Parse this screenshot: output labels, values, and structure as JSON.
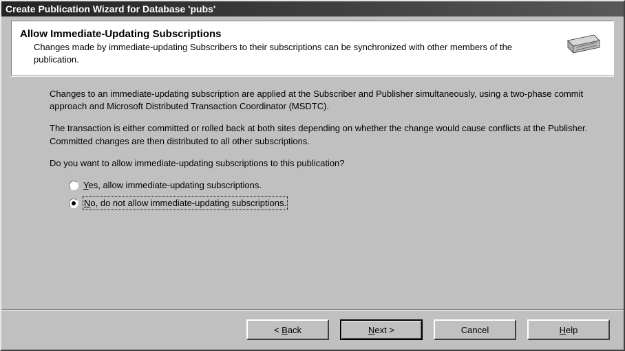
{
  "titlebar": "Create Publication Wizard for Database 'pubs'",
  "header": {
    "title": "Allow Immediate-Updating Subscriptions",
    "description": "Changes made by immediate-updating Subscribers to their subscriptions can be synchronized with other members of the publication."
  },
  "body": {
    "para1": "Changes to an immediate-updating subscription are applied at the Subscriber and Publisher simultaneously, using a two-phase commit approach and Microsoft Distributed Transaction Coordinator (MSDTC).",
    "para2": "The transaction is either committed or rolled back at both sites depending on whether the change would cause conflicts at the Publisher. Committed changes are then distributed to all other subscriptions.",
    "question": "Do you want to allow immediate-updating subscriptions to this publication?"
  },
  "options": {
    "yes_accel": "Y",
    "yes_rest": "es, allow immediate-updating subscriptions.",
    "no_accel": "N",
    "no_rest": "o, do not allow immediate-updating subscriptions.",
    "selected": "no"
  },
  "buttons": {
    "back_pre": "< ",
    "back_accel": "B",
    "back_rest": "ack",
    "next_accel": "N",
    "next_rest": "ext >",
    "cancel": "Cancel",
    "help_accel": "H",
    "help_rest": "elp"
  }
}
